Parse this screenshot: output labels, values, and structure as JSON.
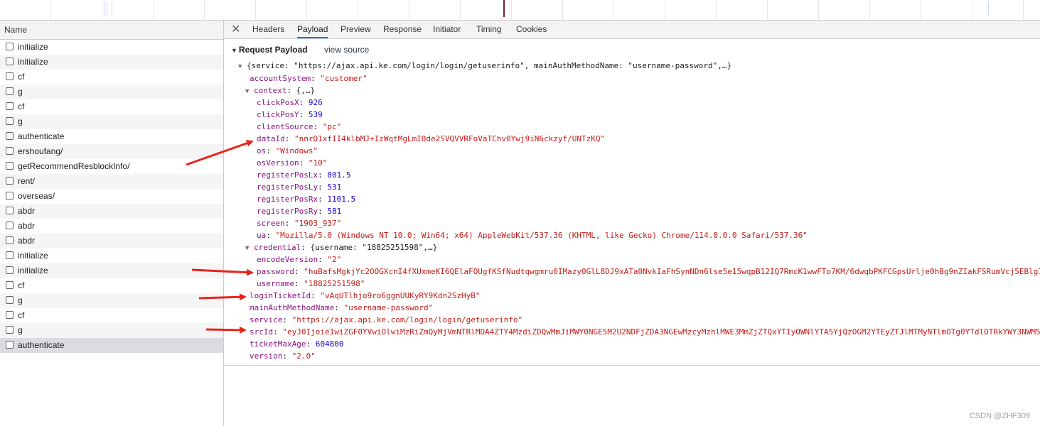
{
  "list": {
    "header": "Name",
    "items": [
      "initialize",
      "initialize",
      "cf",
      "g",
      "cf",
      "g",
      "authenticate",
      "ershoufang/",
      "getRecommendResblockInfo/",
      "rent/",
      "overseas/",
      "abdr",
      "abdr",
      "abdr",
      "initialize",
      "initialize",
      "cf",
      "g",
      "cf",
      "g",
      "authenticate"
    ]
  },
  "tabs": [
    "Headers",
    "Payload",
    "Preview",
    "Response",
    "Initiator",
    "Timing",
    "Cookies"
  ],
  "payload": {
    "section_title": "Request Payload",
    "view_source": "view source",
    "lines": {
      "root": "{service: \"https://ajax.api.ke.com/login/login/getuserinfo\", mainAuthMethodName: \"username-password\",…}",
      "accountSystem_k": "accountSystem",
      "accountSystem_v": "\"customer\"",
      "context_k": "context",
      "context_v": "{,…}",
      "clickPosX_k": "clickPosX",
      "clickPosX_v": "926",
      "clickPosY_k": "clickPosY",
      "clickPosY_v": "539",
      "clientSource_k": "clientSource",
      "clientSource_v": "\"pc\"",
      "dataId_k": "dataId",
      "dataId_v": "\"nnrO1xfII4klbMJ+IzWqtMgLmI0de2SVQVVRFoVaTChv0Ywj9iN6ckzyf/UNTzKQ\"",
      "os_k": "os",
      "os_v": "\"Windows\"",
      "osVersion_k": "osVersion",
      "osVersion_v": "\"10\"",
      "registerPosLx_k": "registerPosLx",
      "registerPosLx_v": "801.5",
      "registerPosLy_k": "registerPosLy",
      "registerPosLy_v": "531",
      "registerPosRx_k": "registerPosRx",
      "registerPosRx_v": "1101.5",
      "registerPosRy_k": "registerPosRy",
      "registerPosRy_v": "581",
      "screen_k": "screen",
      "screen_v": "\"1903_937\"",
      "ua_k": "ua",
      "ua_v": "\"Mozilla/5.0 (Windows NT 10.0; Win64; x64) AppleWebKit/537.36 (KHTML, like Gecko) Chrome/114.0.0.0 Safari/537.36\"",
      "credential_k": "credential",
      "credential_v": "{username: \"18825251598\",…}",
      "encodeVersion_k": "encodeVersion",
      "encodeVersion_v": "\"2\"",
      "password_k": "password",
      "password_v": "\"huBafsMgkjYc2OOGXcnI4fXUxmeKI6QElaFOUgfKSfNudtqwgmru0IMazy0GlL8DJ9xATa0NvkIaFhSynNDn6lse5e15wqpB12IQ7RmcK1wwFTo7KM/6dwqbPKFCGpsUrlje0hBg9nZIakFSRumVcj5EBlg7",
      "username_k": "username",
      "username_v": "\"18825251598\"",
      "loginTicketId_k": "loginTicketId",
      "loginTicketId_v": "\"vAqUTlhjo9ro6ggnUUKyRY9Kdn2SzHyB\"",
      "mainAuthMethodName_k": "mainAuthMethodName",
      "mainAuthMethodName_v": "\"username-password\"",
      "service_k": "service",
      "service_v": "\"https://ajax.api.ke.com/login/login/getuserinfo\"",
      "srcId_k": "srcId",
      "srcId_v": "\"eyJ0Ijoie1wiZGF0YVwiOlwiMzRiZmQyMjVmNTRlMDA4ZTY4MzdiZDQwMmJiMWY0NGE5M2U2NDFjZDA3NGEwMzcyMzhlMWE3MmZjZTQxYTIyOWNlYTA5YjQzOGM2YTEyZTJlMTMyNTlmOTg0YTdlOTRkYWY3NWM5N",
      "ticketMaxAge_k": "ticketMaxAge",
      "ticketMaxAge_v": "604800",
      "version_k": "version",
      "version_v": "\"2.0\""
    }
  },
  "watermark": "CSDN @ZHF309",
  "colors": {
    "key": "#881280",
    "string": "#c41a16",
    "number": "#1c00cf",
    "arrow": "#e8231b"
  }
}
